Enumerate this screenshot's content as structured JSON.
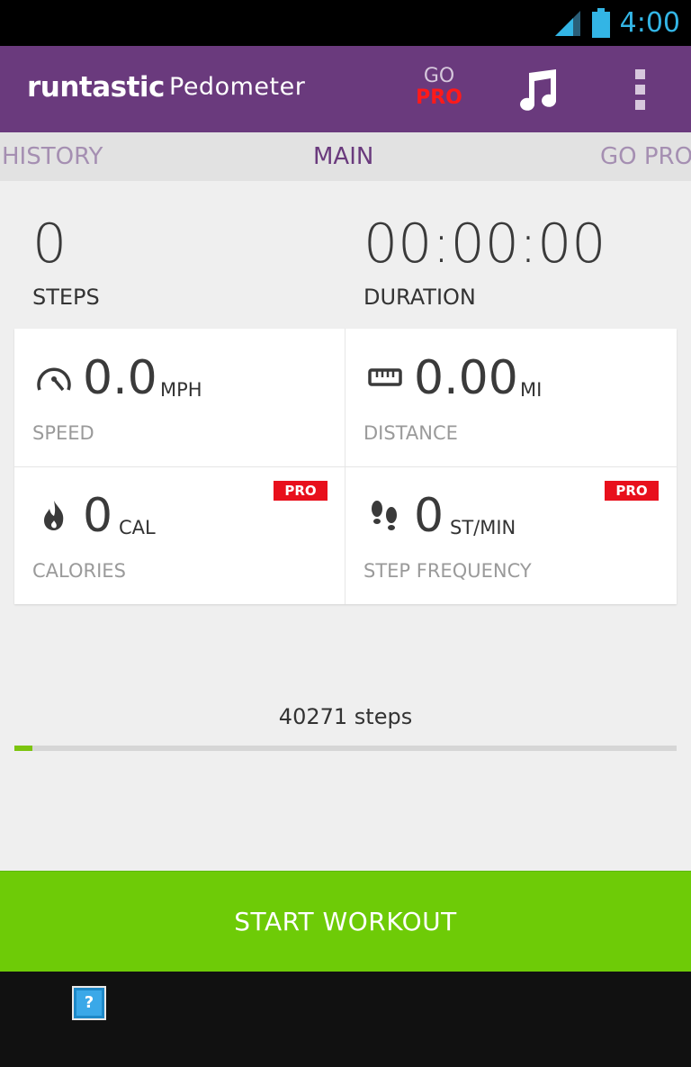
{
  "status_bar": {
    "time": "4:00"
  },
  "app_bar": {
    "logo": "runtastic",
    "title": "Pedometer",
    "go_pro_top": "GO",
    "go_pro_bottom": "PRO"
  },
  "tabs": [
    {
      "label": "HISTORY",
      "active": false
    },
    {
      "label": "MAIN",
      "active": true
    },
    {
      "label": "GO PRO",
      "active": false
    }
  ],
  "summary": {
    "steps_value": "0",
    "steps_label": "STEPS",
    "duration_value": "00:00:00",
    "duration_label": "DURATION"
  },
  "metrics": {
    "speed": {
      "value": "0.0",
      "unit": "MPH",
      "label": "SPEED",
      "icon": "speedometer-icon"
    },
    "distance": {
      "value": "0.00",
      "unit": "MI",
      "label": "DISTANCE",
      "icon": "ruler-icon"
    },
    "calories": {
      "value": "0",
      "unit": "CAL",
      "label": "CALORIES",
      "icon": "flame-icon",
      "badge": "PRO"
    },
    "frequency": {
      "value": "0",
      "unit": "ST/MIN",
      "label": "STEP FREQUENCY",
      "icon": "footprints-icon",
      "badge": "PRO"
    }
  },
  "goal": {
    "text": "40271 steps",
    "progress_fraction": 0.027
  },
  "start_button": {
    "label": "START WORKOUT"
  },
  "colors": {
    "app_bar": "#6a3a7d",
    "accent_green": "#6ecb07",
    "pro_red": "#e8101c",
    "status_blue": "#33b5e5"
  }
}
